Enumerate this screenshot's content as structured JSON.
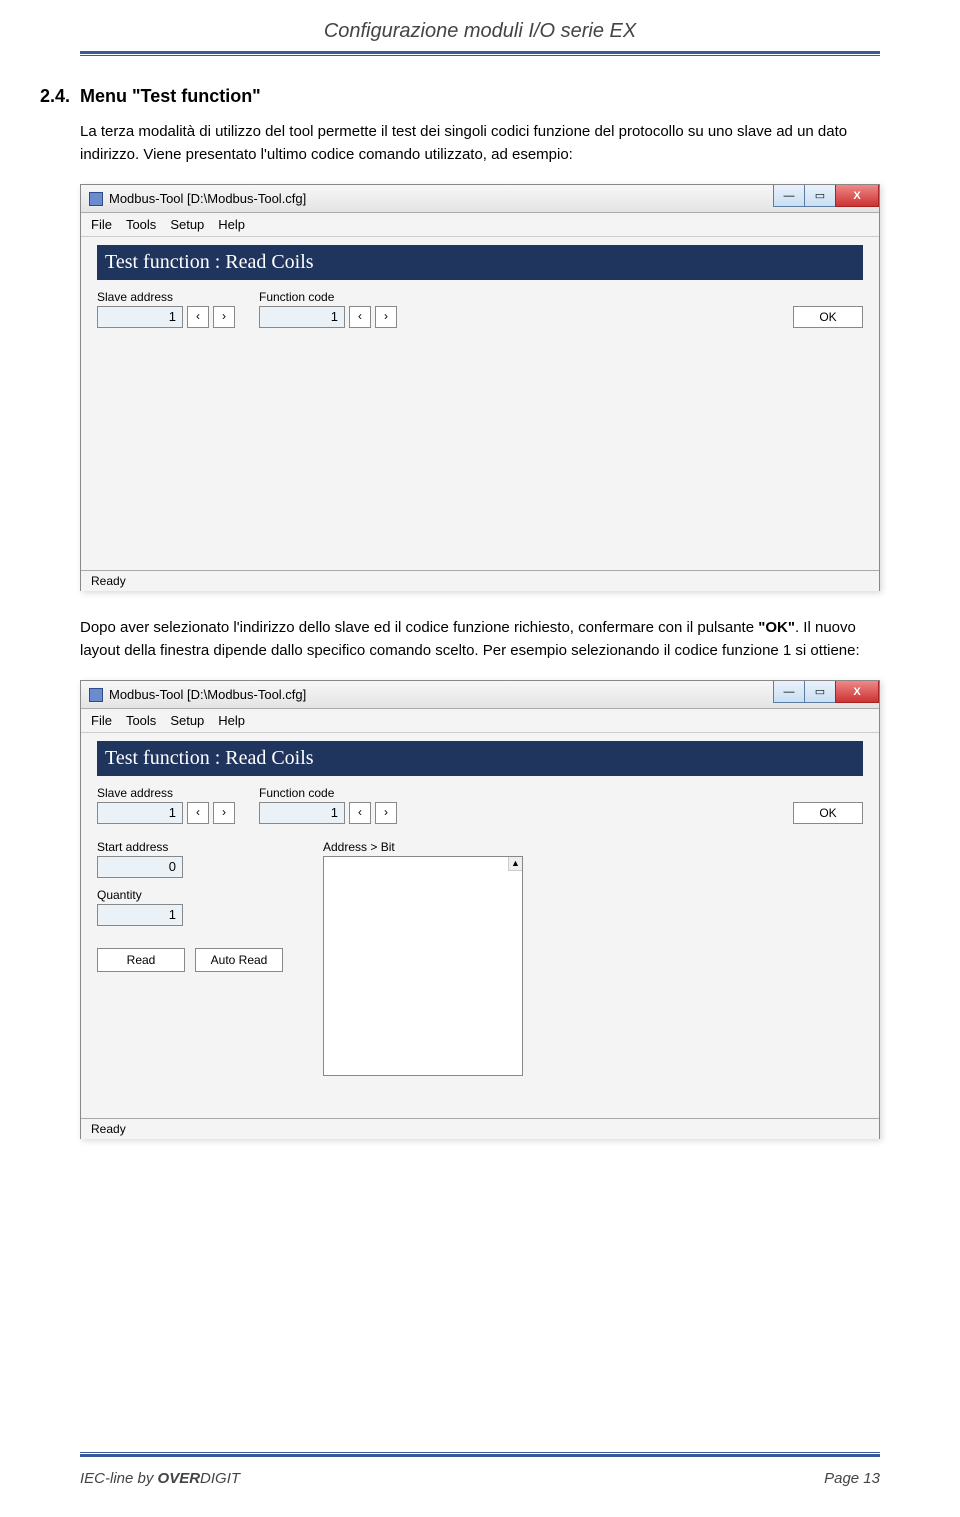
{
  "doc": {
    "header_title": "Configurazione moduli I/O serie EX",
    "section_number": "2.4.",
    "section_title": "Menu \"Test function\"",
    "para1": "La terza modalità di utilizzo del tool permette il test dei singoli codici funzione del protocollo su uno slave ad un dato indirizzo. Viene presentato l'ultimo codice comando utilizzato, ad esempio:",
    "para2_a": "Dopo aver selezionato l'indirizzo dello slave ed il codice funzione richiesto, confermare con il pulsante ",
    "para2_bold": "\"OK\"",
    "para2_b": ". Il nuovo layout della finestra dipende dallo specifico comando scelto. Per esempio selezionando il codice funzione 1 si ottiene:",
    "footer_left_a": "IEC-line by ",
    "footer_left_b1": "OVER",
    "footer_left_b2": "DIGIT",
    "footer_right": "Page 13"
  },
  "window": {
    "title": "Modbus-Tool [D:\\Modbus-Tool.cfg]",
    "menu": [
      "File",
      "Tools",
      "Setup",
      "Help"
    ],
    "bluebar": "Test function : Read Coils",
    "labels": {
      "slave_address": "Slave address",
      "function_code": "Function code",
      "start_address": "Start address",
      "quantity": "Quantity",
      "address_bit": "Address > Bit"
    },
    "values": {
      "slave_address": "1",
      "function_code": "1",
      "start_address": "0",
      "quantity": "1"
    },
    "buttons": {
      "ok": "OK",
      "read": "Read",
      "auto_read": "Auto Read"
    },
    "status": "Ready",
    "winbtn": {
      "min": "—",
      "max": "▭",
      "close": "X"
    },
    "step": {
      "prev": "‹",
      "next": "›"
    }
  }
}
